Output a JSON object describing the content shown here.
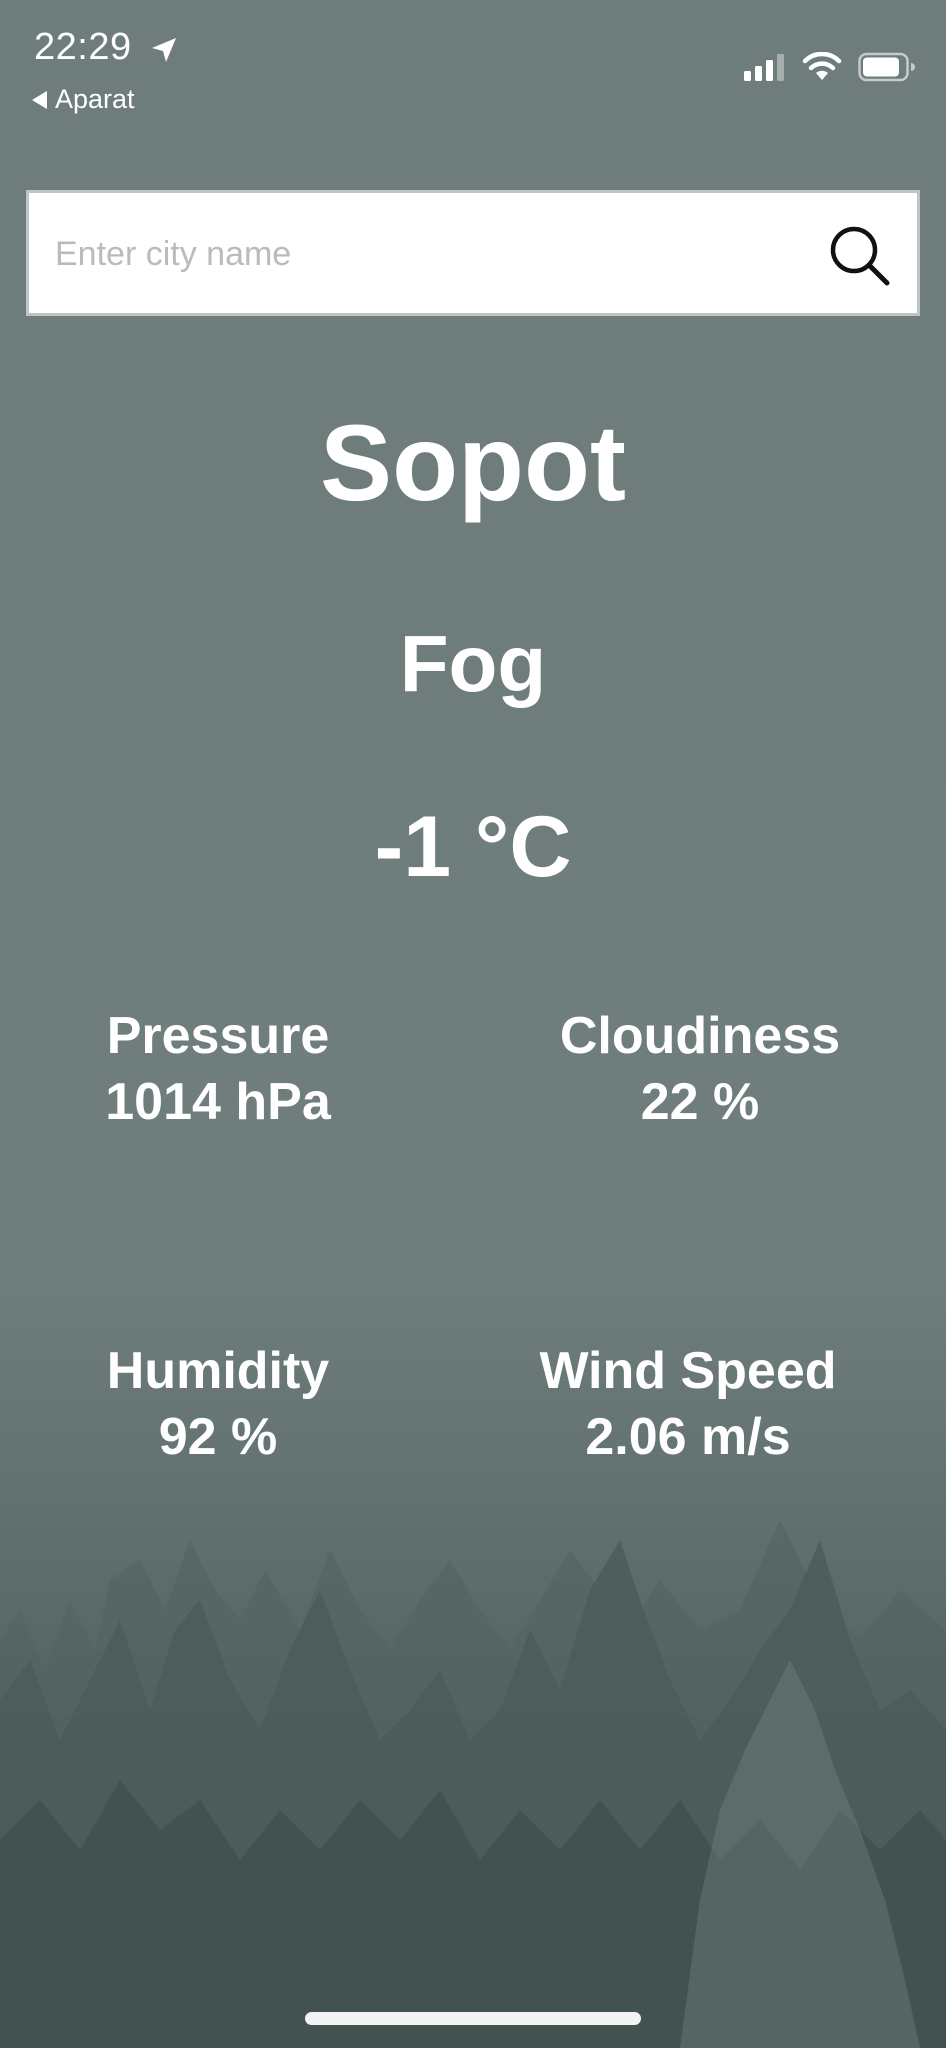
{
  "status_bar": {
    "time": "22:29",
    "back_label": "Aparat"
  },
  "search": {
    "placeholder": "Enter city name",
    "value": ""
  },
  "weather": {
    "city": "Sopot",
    "condition": "Fog",
    "temperature": "-1 °C"
  },
  "stats": {
    "pressure": {
      "label": "Pressure",
      "value": "1014 hPa"
    },
    "cloudiness": {
      "label": "Cloudiness",
      "value": "22 %"
    },
    "humidity": {
      "label": "Humidity",
      "value": "92 %"
    },
    "wind_speed": {
      "label": "Wind Speed",
      "value": "2.06 m/s"
    }
  },
  "icons": {
    "location": "location-arrow-icon",
    "back": "back-triangle-icon",
    "signal": "cellular-signal-icon",
    "wifi": "wifi-icon",
    "battery": "battery-icon",
    "search": "search-icon"
  },
  "colors": {
    "background": "#6e7c7b",
    "fog_trees": "#4a5a57",
    "text": "#ffffff",
    "search_bg": "#ffffff",
    "placeholder": "#b8bcbc"
  }
}
